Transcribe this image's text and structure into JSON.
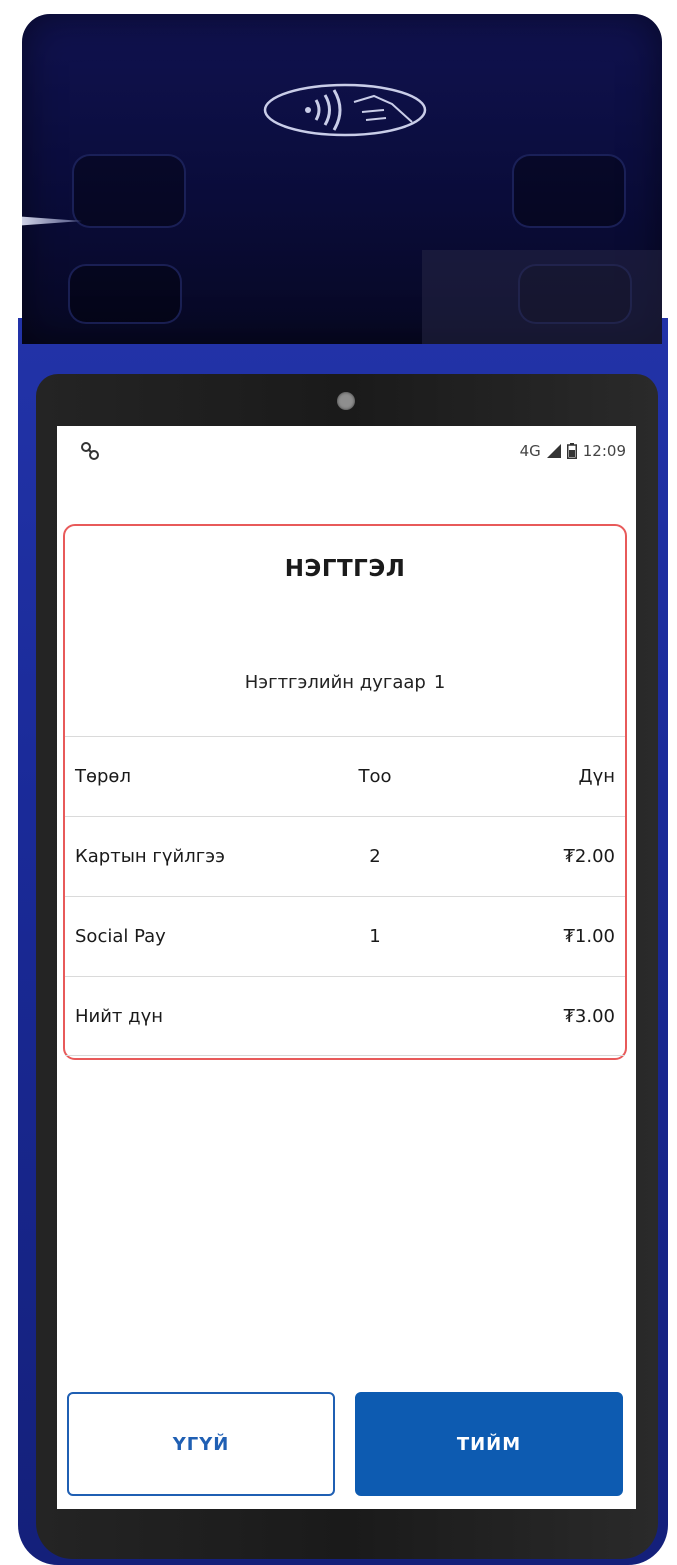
{
  "statusbar": {
    "network": "4G",
    "time": "12:09"
  },
  "dialog": {
    "title": "НЭГТГЭЛ",
    "subtitle_label": "Нэгтгэлийн дугаар",
    "subtitle_number": "1",
    "columns": [
      "Төрөл",
      "Тоо",
      "Дүн"
    ],
    "rows": [
      {
        "type": "Картын гүйлгээ",
        "count": "2",
        "amount": "₮2.00"
      },
      {
        "type": "Social Pay",
        "count": "1",
        "amount": "₮1.00"
      },
      {
        "type": "Нийт дүн",
        "count": "",
        "amount": "₮3.00"
      }
    ]
  },
  "buttons": {
    "no_label": "ҮГҮЙ",
    "yes_label": "ТИЙМ"
  },
  "colors": {
    "primary": "#0d5bb1",
    "card_border": "#e85a5a",
    "device_body": "#1a2a98"
  },
  "icons": [
    "nfc-contactless-icon",
    "link-icon",
    "signal-icon",
    "battery-icon"
  ]
}
